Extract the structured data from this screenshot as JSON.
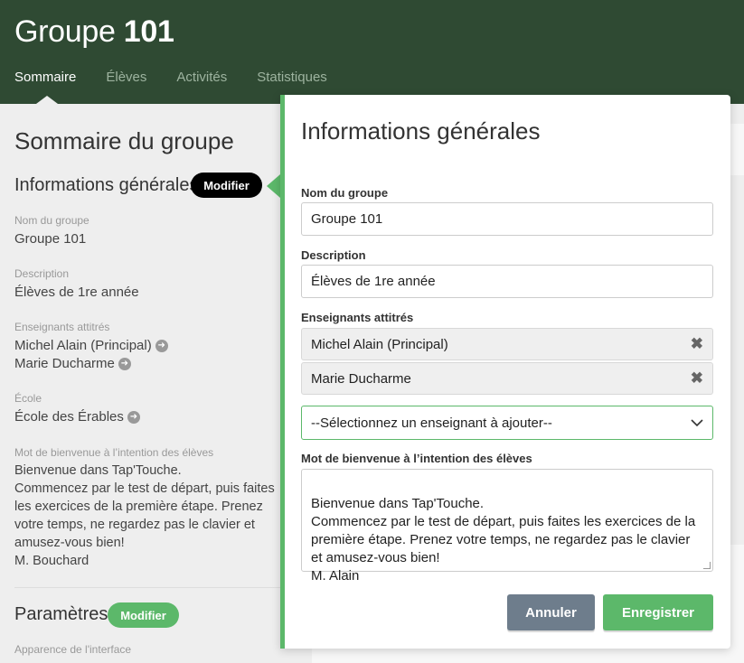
{
  "header": {
    "title_prefix": "Groupe",
    "title_number": "101",
    "tabs": [
      {
        "label": "Sommaire",
        "active": true
      },
      {
        "label": "Élèves",
        "active": false
      },
      {
        "label": "Activités",
        "active": false
      },
      {
        "label": "Statistiques",
        "active": false
      }
    ]
  },
  "summary": {
    "title": "Sommaire du groupe",
    "general_info": {
      "heading": "Informations générales",
      "edit_label": "Modifier",
      "group_name_label": "Nom du groupe",
      "group_name_value": "Groupe 101",
      "description_label": "Description",
      "description_value": "Élèves de 1re année",
      "teachers_label": "Enseignants attitrés",
      "teachers": [
        "Michel Alain (Principal)",
        "Marie Ducharme"
      ],
      "school_label": "École",
      "school_value": "École des Érables",
      "welcome_label": "Mot de bienvenue à l’intention des élèves",
      "welcome_value": "Bienvenue dans Tap'Touche.\nCommencez par le test de départ, puis faites les exercices de la première étape. Prenez votre temps, ne regardez pas le clavier et amusez-vous bien!\nM. Bouchard"
    },
    "settings": {
      "heading": "Paramètres",
      "edit_label": "Modifier",
      "interface_label": "Apparence de l'interface"
    }
  },
  "modal": {
    "title": "Informations générales",
    "group_name_label": "Nom du groupe",
    "group_name_value": "Groupe 101",
    "description_label": "Description",
    "description_value": "Élèves de 1re année",
    "teachers_label": "Enseignants attitrés",
    "teachers": [
      "Michel Alain (Principal)",
      "Marie Ducharme"
    ],
    "remove_glyph": "✖",
    "select_placeholder": "--Sélectionnez un enseignant à ajouter--",
    "welcome_label": "Mot de bienvenue à l’intention des élèves",
    "welcome_value": "Bienvenue dans Tap'Touche.\nCommencez par le test de départ, puis faites les exercices de la première étape. Prenez votre temps, ne regardez pas le clavier et amusez-vous bien!\nM. Alain",
    "cancel_label": "Annuler",
    "save_label": "Enregistrer"
  },
  "colors": {
    "header_bg": "#2f4a33",
    "accent_green": "#5cb86a",
    "cancel_gray": "#6e7d8c"
  }
}
